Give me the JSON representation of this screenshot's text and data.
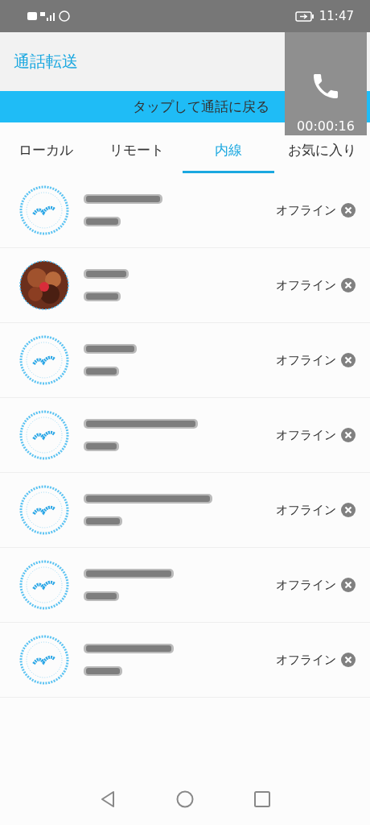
{
  "status_bar": {
    "time": "11:47"
  },
  "header": {
    "title": "通話転送"
  },
  "banner": {
    "text": "タップして通話に戻る"
  },
  "call_overlay": {
    "timer": "00:00:16"
  },
  "tabs": [
    {
      "label": "ローカル",
      "selected": false
    },
    {
      "label": "リモート",
      "selected": false
    },
    {
      "label": "内線",
      "selected": true
    },
    {
      "label": "お気に入り",
      "selected": false
    }
  ],
  "contacts": [
    {
      "kind": "default",
      "status": "オフライン"
    },
    {
      "kind": "picture",
      "status": "オフライン"
    },
    {
      "kind": "default",
      "status": "オフライン"
    },
    {
      "kind": "default",
      "status": "オフライン"
    },
    {
      "kind": "default",
      "status": "オフライン"
    },
    {
      "kind": "default",
      "status": "オフライン"
    },
    {
      "kind": "default",
      "status": "オフライン"
    }
  ]
}
